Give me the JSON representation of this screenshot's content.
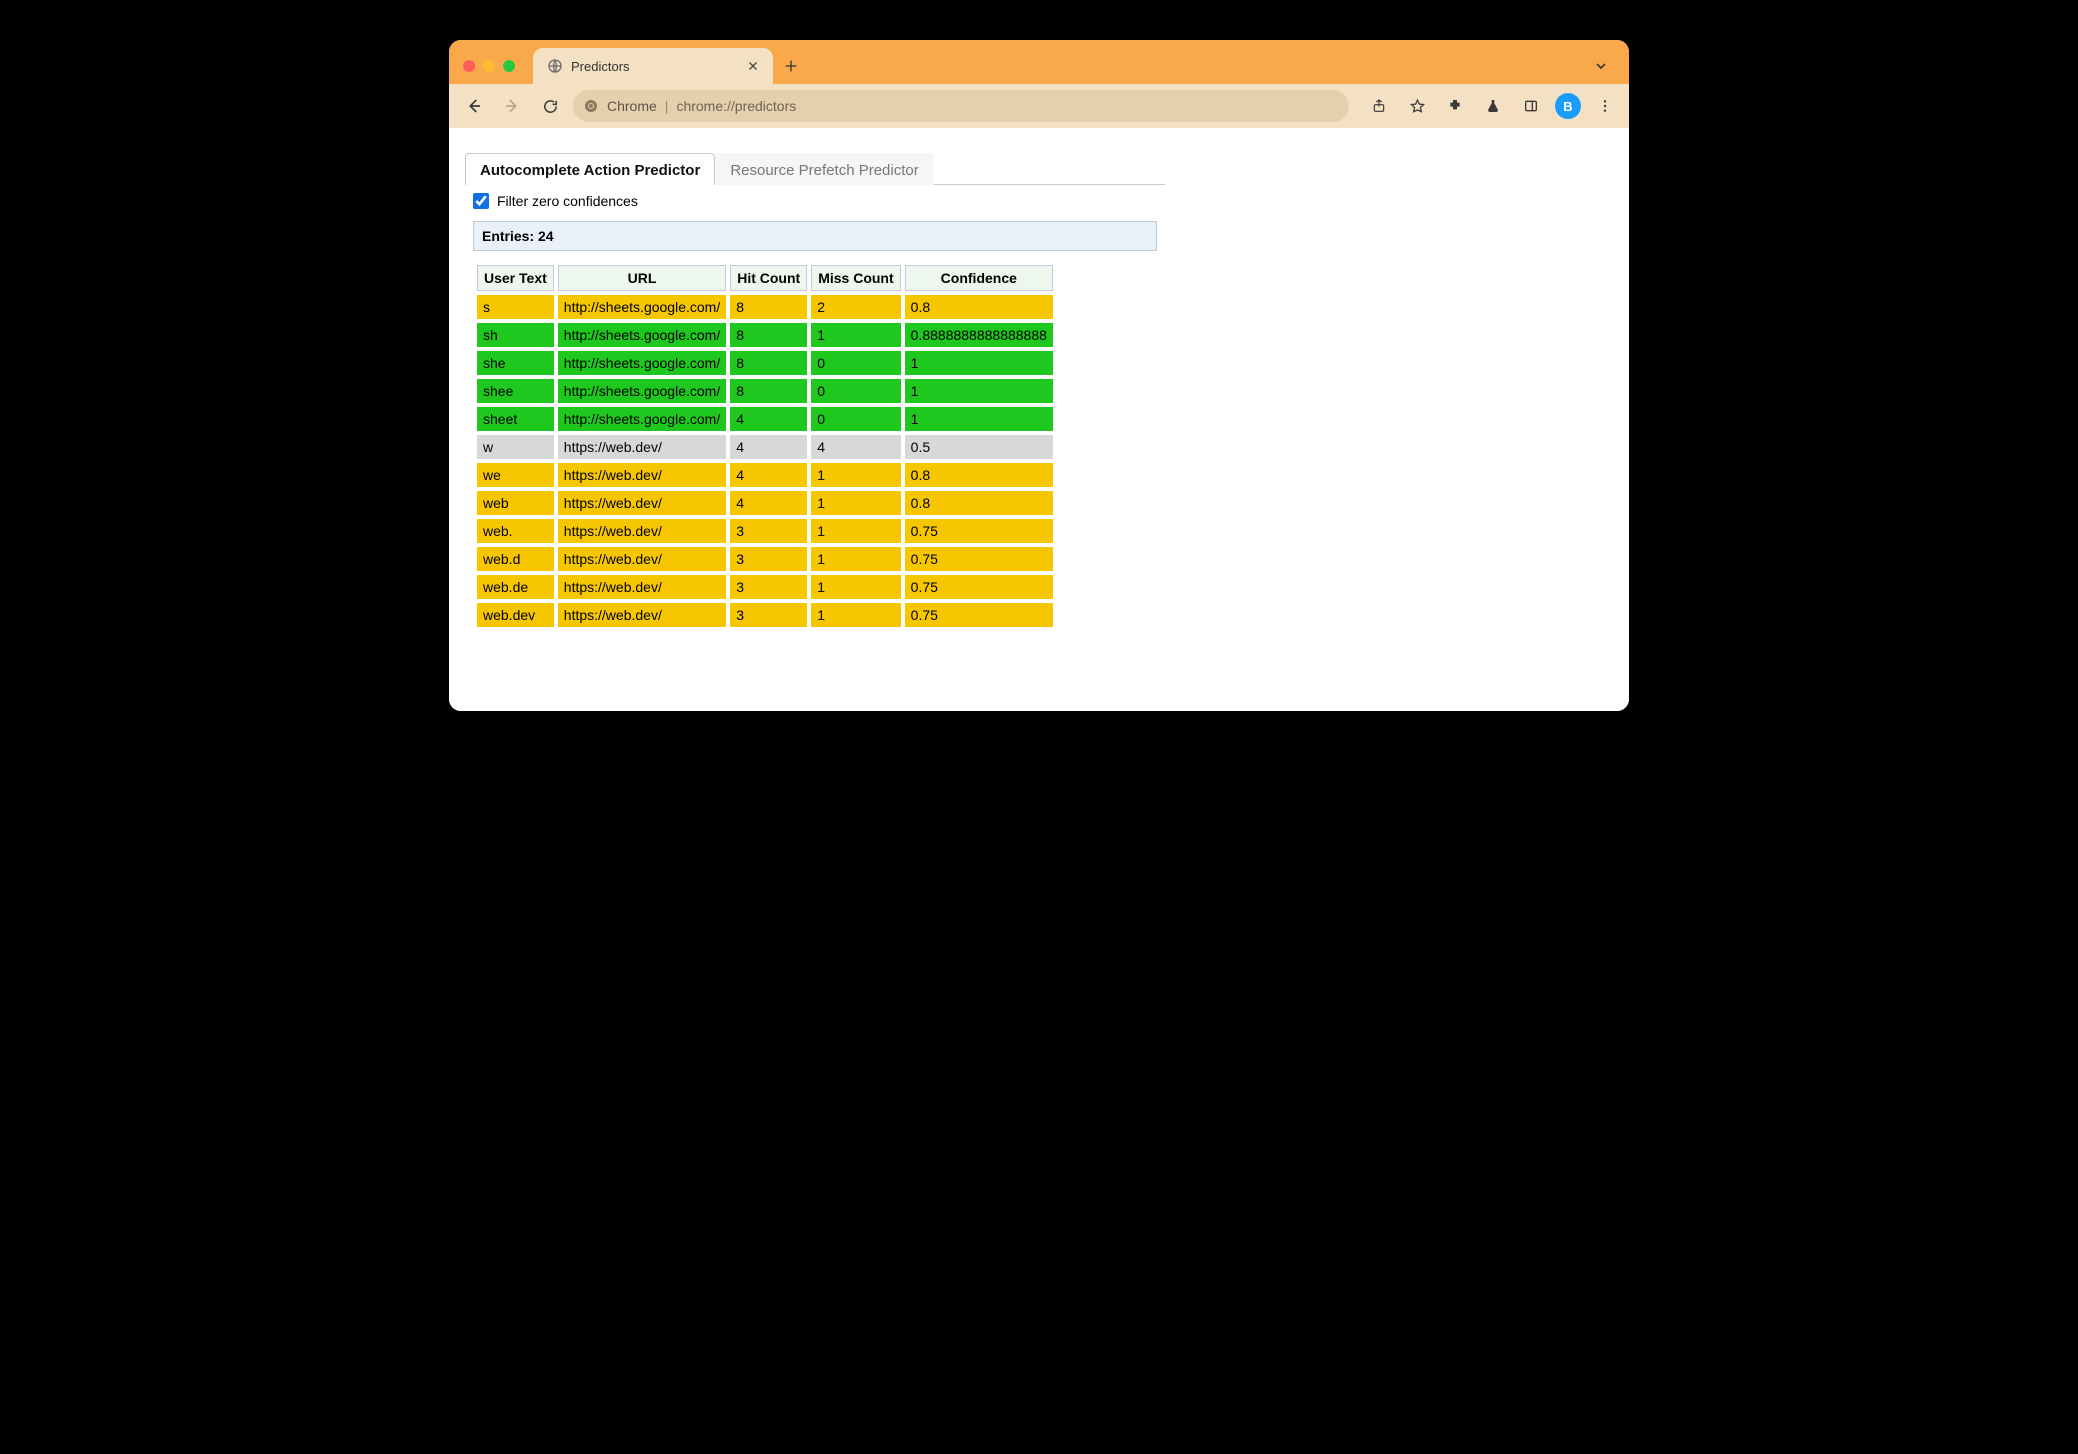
{
  "browser": {
    "tab_title": "Predictors",
    "omnibox": {
      "scheme_label": "Chrome",
      "url": "chrome://predictors"
    },
    "avatar_initial": "B"
  },
  "page": {
    "tabs": {
      "active": "Autocomplete Action Predictor",
      "inactive": "Resource Prefetch Predictor"
    },
    "filter_label": "Filter zero confidences",
    "filter_checked": true,
    "entries_label_prefix": "Entries: ",
    "entries_count": "24",
    "columns": {
      "user_text": "User Text",
      "url": "URL",
      "hit_count": "Hit Count",
      "miss_count": "Miss Count",
      "confidence": "Confidence"
    },
    "rows": [
      {
        "user_text": "s",
        "url": "http://sheets.google.com/",
        "hit": "8",
        "miss": "2",
        "confidence": "0.8",
        "level": "yellow"
      },
      {
        "user_text": "sh",
        "url": "http://sheets.google.com/",
        "hit": "8",
        "miss": "1",
        "confidence": "0.8888888888888888",
        "level": "green"
      },
      {
        "user_text": "she",
        "url": "http://sheets.google.com/",
        "hit": "8",
        "miss": "0",
        "confidence": "1",
        "level": "green"
      },
      {
        "user_text": "shee",
        "url": "http://sheets.google.com/",
        "hit": "8",
        "miss": "0",
        "confidence": "1",
        "level": "green"
      },
      {
        "user_text": "sheet",
        "url": "http://sheets.google.com/",
        "hit": "4",
        "miss": "0",
        "confidence": "1",
        "level": "green"
      },
      {
        "user_text": "w",
        "url": "https://web.dev/",
        "hit": "4",
        "miss": "4",
        "confidence": "0.5",
        "level": "gray"
      },
      {
        "user_text": "we",
        "url": "https://web.dev/",
        "hit": "4",
        "miss": "1",
        "confidence": "0.8",
        "level": "yellow"
      },
      {
        "user_text": "web",
        "url": "https://web.dev/",
        "hit": "4",
        "miss": "1",
        "confidence": "0.8",
        "level": "yellow"
      },
      {
        "user_text": "web.",
        "url": "https://web.dev/",
        "hit": "3",
        "miss": "1",
        "confidence": "0.75",
        "level": "yellow"
      },
      {
        "user_text": "web.d",
        "url": "https://web.dev/",
        "hit": "3",
        "miss": "1",
        "confidence": "0.75",
        "level": "yellow"
      },
      {
        "user_text": "web.de",
        "url": "https://web.dev/",
        "hit": "3",
        "miss": "1",
        "confidence": "0.75",
        "level": "yellow"
      },
      {
        "user_text": "web.dev",
        "url": "https://web.dev/",
        "hit": "3",
        "miss": "1",
        "confidence": "0.75",
        "level": "yellow"
      }
    ]
  }
}
